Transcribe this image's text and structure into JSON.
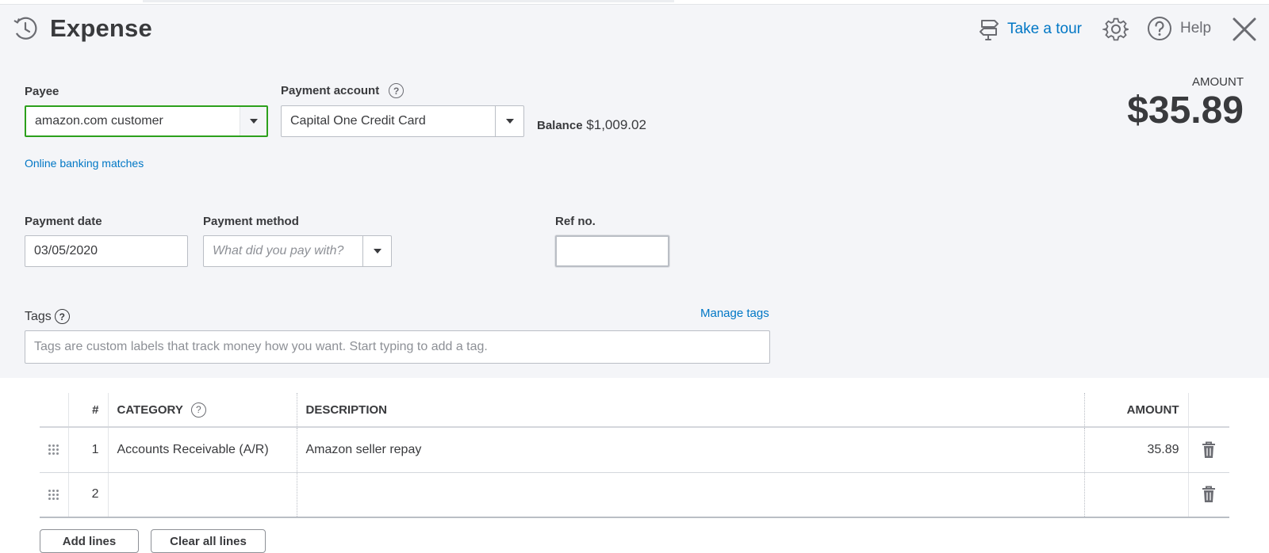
{
  "header": {
    "title": "Expense",
    "tour_label": "Take a tour",
    "help_label": "Help",
    "icons": [
      "recurring-clock-icon",
      "signpost-icon",
      "gear-icon",
      "help-circle-icon",
      "close-icon"
    ]
  },
  "summary": {
    "amount_label": "AMOUNT",
    "amount_value": "$35.89"
  },
  "payee": {
    "label": "Payee",
    "value": "amazon.com customer"
  },
  "payment_account": {
    "label": "Payment account",
    "value": "Capital One Credit Card",
    "balance_label": "Balance",
    "balance_value": "$1,009.02"
  },
  "online_banking_link": "Online banking matches",
  "payment_date": {
    "label": "Payment date",
    "value": "03/05/2020"
  },
  "payment_method": {
    "label": "Payment method",
    "placeholder": "What did you pay with?"
  },
  "ref_no": {
    "label": "Ref no.",
    "value": ""
  },
  "tags": {
    "label": "Tags",
    "manage_label": "Manage tags",
    "placeholder": "Tags are custom labels that track money how you want. Start typing to add a tag."
  },
  "lines_table": {
    "headers": {
      "num": "#",
      "category": "CATEGORY",
      "description": "DESCRIPTION",
      "amount": "AMOUNT"
    },
    "rows": [
      {
        "num": "1",
        "category": "Accounts Receivable (A/R)",
        "description": "Amazon seller repay",
        "amount": "35.89"
      },
      {
        "num": "2",
        "category": "",
        "description": "",
        "amount": ""
      }
    ]
  },
  "buttons": {
    "add_lines": "Add lines",
    "clear_all_lines": "Clear all lines"
  },
  "colors": {
    "accent_link": "#0077c5",
    "panel_bg": "#f4f5f8",
    "focus_green": "#2ca01c",
    "text": "#393a3d"
  }
}
